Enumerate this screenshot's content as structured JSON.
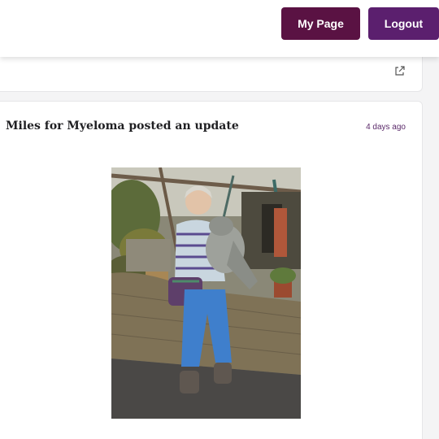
{
  "header": {
    "my_page_label": "My Page",
    "logout_label": "Logout"
  },
  "post": {
    "title": "Miles for Myeloma posted an update",
    "time": "4 days ago"
  },
  "colors": {
    "my_page_button": "#5a1243",
    "logout_button": "#5b1f6e",
    "time_text": "#5b2a6a"
  },
  "icons": {
    "share": "share-icon"
  }
}
